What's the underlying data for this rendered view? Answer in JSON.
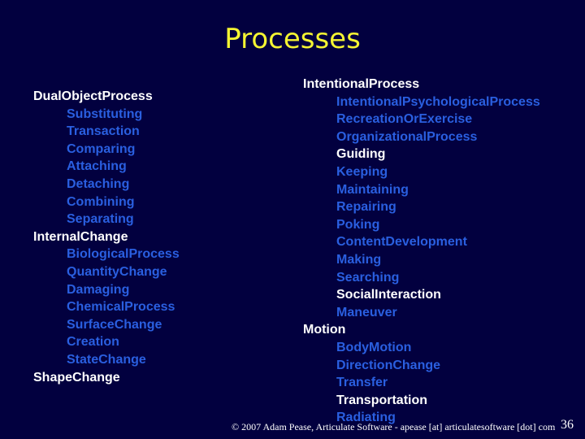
{
  "slide": {
    "title": "Processes",
    "colors": {
      "background": "#02003f",
      "title": "#f4f432",
      "primary_text": "#ffffff",
      "secondary_text": "#2a5fe0"
    },
    "left_column": [
      {
        "text": "DualObjectProcess",
        "level": 0,
        "style": "white"
      },
      {
        "text": "Substituting",
        "level": 1,
        "style": "blue"
      },
      {
        "text": "Transaction",
        "level": 1,
        "style": "blue"
      },
      {
        "text": "Comparing",
        "level": 1,
        "style": "blue"
      },
      {
        "text": "Attaching",
        "level": 1,
        "style": "blue"
      },
      {
        "text": "Detaching",
        "level": 1,
        "style": "blue"
      },
      {
        "text": "Combining",
        "level": 1,
        "style": "blue"
      },
      {
        "text": "Separating",
        "level": 1,
        "style": "blue"
      },
      {
        "text": "InternalChange",
        "level": 0,
        "style": "white"
      },
      {
        "text": "BiologicalProcess",
        "level": 1,
        "style": "blue"
      },
      {
        "text": "QuantityChange",
        "level": 1,
        "style": "blue"
      },
      {
        "text": "Damaging",
        "level": 1,
        "style": "blue"
      },
      {
        "text": "ChemicalProcess",
        "level": 1,
        "style": "blue"
      },
      {
        "text": "SurfaceChange",
        "level": 1,
        "style": "blue"
      },
      {
        "text": "Creation",
        "level": 1,
        "style": "blue"
      },
      {
        "text": "StateChange",
        "level": 1,
        "style": "blue"
      },
      {
        "text": "ShapeChange",
        "level": 0,
        "style": "white"
      }
    ],
    "right_column": [
      {
        "text": "IntentionalProcess",
        "level": 0,
        "style": "white"
      },
      {
        "text": "IntentionalPsychologicalProcess",
        "level": 1,
        "style": "blue"
      },
      {
        "text": "RecreationOrExercise",
        "level": 1,
        "style": "blue"
      },
      {
        "text": "OrganizationalProcess",
        "level": 1,
        "style": "blue"
      },
      {
        "text": "Guiding",
        "level": 1,
        "style": "white"
      },
      {
        "text": "Keeping",
        "level": 1,
        "style": "blue"
      },
      {
        "text": "Maintaining",
        "level": 1,
        "style": "blue"
      },
      {
        "text": "Repairing",
        "level": 1,
        "style": "blue"
      },
      {
        "text": "Poking",
        "level": 1,
        "style": "blue"
      },
      {
        "text": "ContentDevelopment",
        "level": 1,
        "style": "blue"
      },
      {
        "text": "Making",
        "level": 1,
        "style": "blue"
      },
      {
        "text": "Searching",
        "level": 1,
        "style": "blue"
      },
      {
        "text": "SocialInteraction",
        "level": 1,
        "style": "white"
      },
      {
        "text": "Maneuver",
        "level": 1,
        "style": "blue"
      },
      {
        "text": "Motion",
        "level": 0,
        "style": "white"
      },
      {
        "text": "BodyMotion",
        "level": 1,
        "style": "blue"
      },
      {
        "text": "DirectionChange",
        "level": 1,
        "style": "blue"
      },
      {
        "text": "Transfer",
        "level": 1,
        "style": "blue"
      },
      {
        "text": "Transportation",
        "level": 1,
        "style": "white"
      },
      {
        "text": "Radiating",
        "level": 1,
        "style": "blue"
      }
    ],
    "footer": "© 2007 Adam Pease, Articulate Software - apease [at] articulatesoftware [dot] com",
    "page_number": "36"
  }
}
